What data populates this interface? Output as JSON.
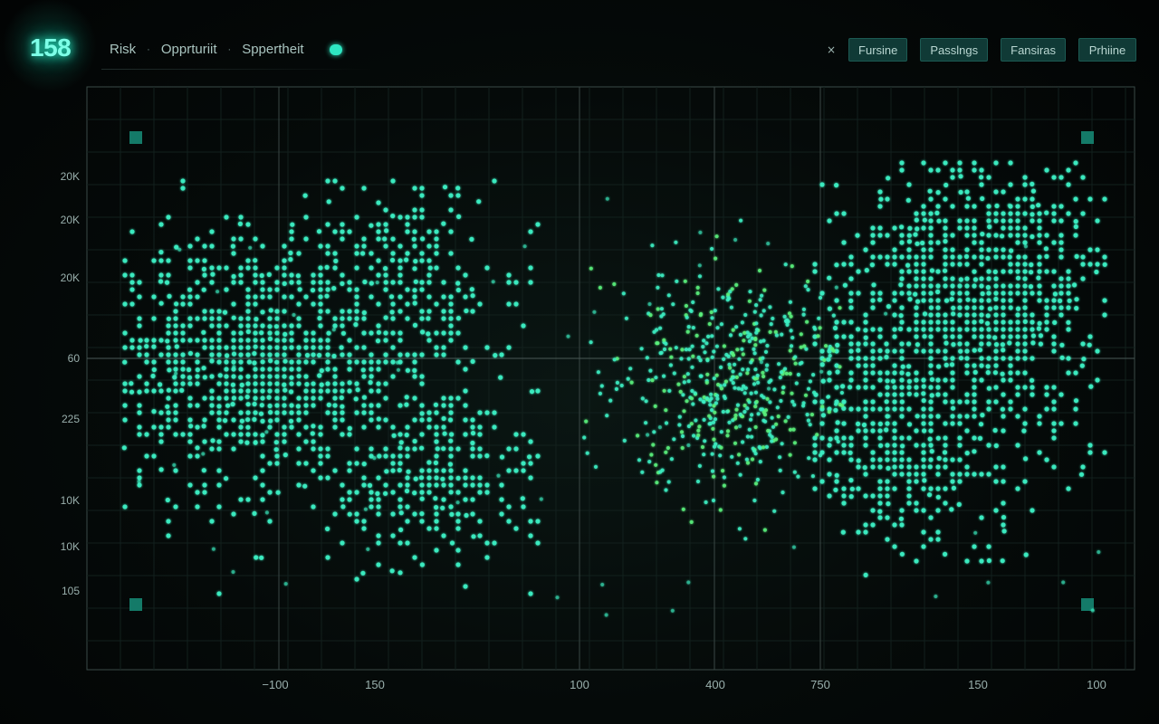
{
  "logo": {
    "text": "158"
  },
  "breadcrumb": {
    "items": [
      "Risk",
      "Opprturiit",
      "Sppertheit"
    ],
    "separator": "·"
  },
  "filters": {
    "close_glyph": "×",
    "buttons": [
      "Fursine",
      "Passlngs",
      "Fansiras",
      "Prhiine"
    ]
  },
  "colors": {
    "accent": "#2ee6c2",
    "point": "#3cf0c3",
    "point_alt": "#5af27d",
    "button_bg": "#103a36",
    "corner_marker": "#147a68"
  },
  "chart_data": {
    "type": "scatter",
    "grid": true,
    "y_tick_labels": [
      "20K",
      "20K",
      "20K",
      "60",
      "225",
      "10K",
      "10K",
      "105"
    ],
    "x_tick_labels": [
      "−100",
      "150",
      "100",
      "400",
      "750",
      "150",
      "100"
    ],
    "clusters": [
      {
        "name": "",
        "grid_points": true
      },
      {
        "name": "",
        "grid_points": true
      }
    ]
  }
}
